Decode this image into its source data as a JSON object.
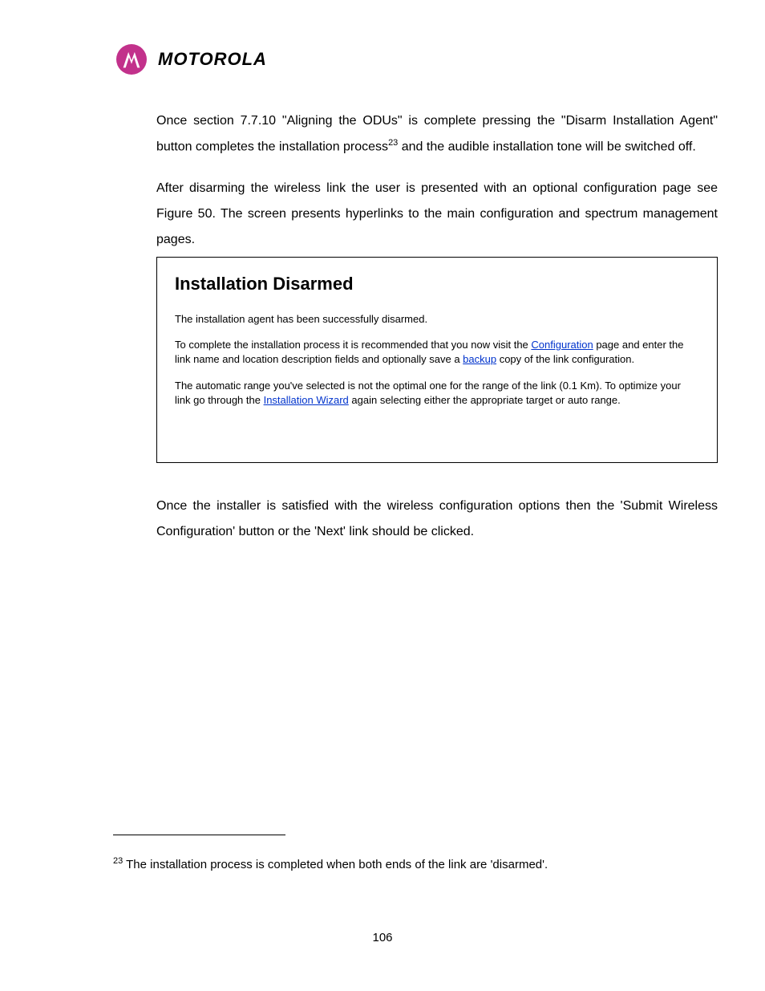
{
  "header": {
    "brand": "MOTOROLA",
    "logo_icon": "motorola-batwing-icon"
  },
  "body": {
    "p1_part1": "Once section 7.7.10 \"Aligning the ODUs\" is complete pressing the \"Disarm Installation Agent\" button completes the installation process",
    "p1_footref": "23",
    "p1_part2": " and the audible installation tone will be switched off.",
    "p2": "After disarming the wireless link the user is presented with an optional configuration page see Figure 50. The screen presents hyperlinks to the main configuration and spectrum management pages."
  },
  "figure": {
    "title": "Installation Disarmed",
    "p1": "The installation agent has been successfully disarmed.",
    "p2_a": "To complete the installation process it is recommended that you now visit the ",
    "p2_link1": "Configuration",
    "p2_b": " page and enter the link name and location description fields and optionally save a ",
    "p2_link2": "backup",
    "p2_c": " copy of the link configuration.",
    "p3_a": "The automatic range you've selected is not the optimal one for the range of the link (0.1 Km). To optimize your link go through the ",
    "p3_link": "Installation Wizard",
    "p3_b": " again selecting either the appropriate target or auto range."
  },
  "after": {
    "p1": "Once the installer is satisfied with the wireless configuration options then the 'Submit Wireless Configuration' button or the 'Next' link should be clicked."
  },
  "footnote": {
    "num": "23",
    "text": " The installation process is completed when both ends of the link are 'disarmed'."
  },
  "page_number": "106"
}
